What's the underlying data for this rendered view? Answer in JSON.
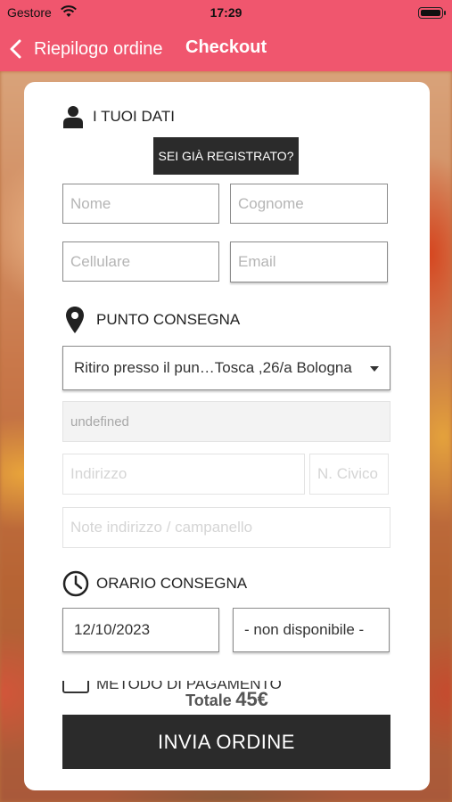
{
  "status_bar": {
    "carrier": "Gestore",
    "time": "17:29"
  },
  "nav": {
    "back_label": "Riepilogo ordine",
    "title": "Checkout"
  },
  "dati": {
    "heading": "I TUOI DATI",
    "registered_button": "SEI GIÀ REGISTRATO?",
    "nome_placeholder": "Nome",
    "cognome_placeholder": "Cognome",
    "cellulare_placeholder": "Cellulare",
    "email_placeholder": "Email"
  },
  "consegna": {
    "heading": "PUNTO CONSEGNA",
    "selected_point": "Ritiro presso il pun…Tosca ,26/a Bologna",
    "city_value": "undefined",
    "indirizzo_placeholder": "Indirizzo",
    "civico_placeholder": "N. Civico",
    "note_placeholder": "Note indirizzo / campanello"
  },
  "orario": {
    "heading": "ORARIO CONSEGNA",
    "date_value": "12/10/2023",
    "time_value": "- non disponibile -"
  },
  "pagamento": {
    "heading": "METODO DI PAGAMENTO"
  },
  "totale": {
    "label": "Totale",
    "amount": "45€"
  },
  "submit_label": "INVIA ORDINE",
  "colors": {
    "header": "#f0566e",
    "button": "#2b2b2b"
  }
}
